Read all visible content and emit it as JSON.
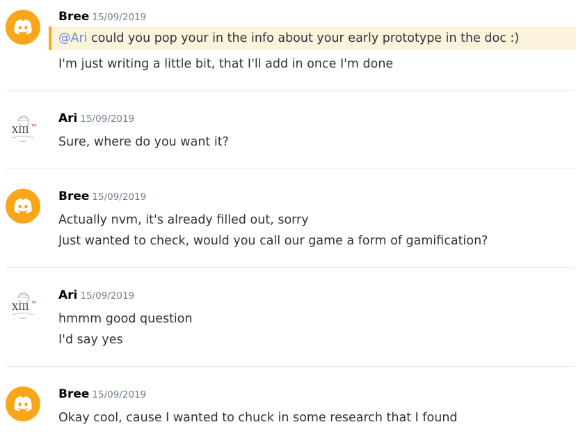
{
  "messages": [
    {
      "author": "Bree",
      "avatar_icon": "discord-logo-icon",
      "timestamp": "15/09/2019",
      "lines": [
        {
          "mention": "@Ari",
          "text": " could you pop your in the info about your early prototype in the doc :)"
        },
        {
          "text": "I'm just writing a little bit, that I'll add in once I'm done"
        }
      ]
    },
    {
      "author": "Ari",
      "avatar_icon": "xiii-sketch-avatar-icon",
      "timestamp": "15/09/2019",
      "lines": [
        {
          "text": "Sure, where do you want it?"
        }
      ]
    },
    {
      "author": "Bree",
      "avatar_icon": "discord-logo-icon",
      "timestamp": "15/09/2019",
      "lines": [
        {
          "text": "Actually nvm, it's already filled out, sorry"
        },
        {
          "text": "Just wanted to check, would you call our game a form of gamification?"
        }
      ]
    },
    {
      "author": "Ari",
      "avatar_icon": "xiii-sketch-avatar-icon",
      "timestamp": "15/09/2019",
      "lines": [
        {
          "text": "hmmm good question"
        },
        {
          "text": "I'd say yes"
        }
      ]
    },
    {
      "author": "Bree",
      "avatar_icon": "discord-logo-icon",
      "timestamp": "15/09/2019",
      "lines": [
        {
          "text": "Okay cool, cause I wanted to chuck in some research that I found"
        }
      ]
    }
  ],
  "avatar_text": {
    "xiii": "XIII",
    "tm": "TM",
    "sig": "HAFA"
  },
  "colors": {
    "discord_orange": "#faa61a",
    "mention_blue": "#7289da",
    "highlight_bg": "#fbf3dc",
    "text": "#2e3338",
    "timestamp": "#747f8d",
    "divider": "#e3e5e8"
  }
}
